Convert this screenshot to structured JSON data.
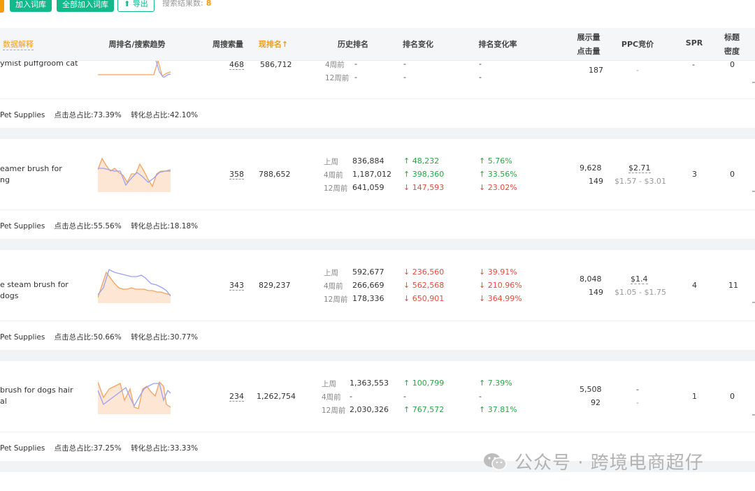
{
  "toolbar": {
    "add_btn": "加入词库",
    "add_all_btn": "全部加入词库",
    "export_btn": "导出",
    "result_label": "搜索结果数:",
    "result_count": "8"
  },
  "header": {
    "data_explain": "数据解释",
    "trend": "周排名/搜索趋势",
    "weekly_search": "周搜索量",
    "current_rank": "现排名↑",
    "history_rank": "历史排名",
    "rank_change": "排名变化",
    "rank_change_rate": "排名变化率",
    "impressions": "展示量",
    "clicks": "点击量",
    "ppc": "PPC竞价",
    "spr": "SPR",
    "title_density_1": "标题",
    "title_density_2": "密度"
  },
  "rows": [
    {
      "keyword_1": "ymist puffgroom cat",
      "keyword_2": "",
      "weekly_search": "468",
      "current_rank": "586,712",
      "hist": [
        {
          "label": "4周前",
          "value": "-",
          "change": "-",
          "rate": "-"
        },
        {
          "label": "12周前",
          "value": "-",
          "change": "-",
          "rate": "-"
        }
      ],
      "impressions": "",
      "clicks": "187",
      "ppc": "-",
      "ppc_range": "",
      "spr": "-",
      "density": "0",
      "category": "Pet Supplies",
      "click_share": "点击总占比:73.39%",
      "conv_share": "转化总占比:42.10%"
    },
    {
      "keyword_1": "eamer brush for",
      "keyword_2": "ng",
      "weekly_search": "358",
      "current_rank": "788,652",
      "hist": [
        {
          "label": "上周",
          "value": "836,884",
          "change": "48,232",
          "rate": "5.76%"
        },
        {
          "label": "4周前",
          "value": "1,187,012",
          "change": "398,360",
          "rate": "33.56%"
        },
        {
          "label": "12周前",
          "value": "641,059",
          "change": "147,593",
          "rate": "23.02%"
        }
      ],
      "impressions": "9,628",
      "clicks": "149",
      "ppc": "$2.71",
      "ppc_range": "$1.57 - $3.01",
      "spr": "3",
      "density": "0",
      "category": "Pet Supplies",
      "click_share": "点击总占比:55.56%",
      "conv_share": "转化总占比:18.18%"
    },
    {
      "keyword_1": "e steam brush for dogs",
      "keyword_2": "",
      "weekly_search": "343",
      "current_rank": "829,237",
      "hist": [
        {
          "label": "上周",
          "value": "592,677",
          "change": "236,560",
          "rate": "39.91%"
        },
        {
          "label": "4周前",
          "value": "266,669",
          "change": "562,568",
          "rate": "210.96%"
        },
        {
          "label": "12周前",
          "value": "178,336",
          "change": "650,901",
          "rate": "364.99%"
        }
      ],
      "impressions": "8,048",
      "clicks": "149",
      "ppc": "$1.4",
      "ppc_range": "$1.05 - $1.75",
      "spr": "4",
      "density": "11",
      "category": "Pet Supplies",
      "click_share": "点击总占比:50.66%",
      "conv_share": "转化总占比:30.77%"
    },
    {
      "keyword_1": "brush for dogs hair",
      "keyword_2": "al",
      "weekly_search": "234",
      "current_rank": "1,262,754",
      "hist": [
        {
          "label": "上周",
          "value": "1,363,553",
          "change": "100,799",
          "rate": "7.39%"
        },
        {
          "label": "4周前",
          "value": "-",
          "change": "-",
          "rate": "-"
        },
        {
          "label": "12周前",
          "value": "2,030,326",
          "change": "767,572",
          "rate": "37.81%"
        }
      ],
      "impressions": "5,508",
      "clicks": "92",
      "ppc": "-",
      "ppc_range": "-",
      "spr": "1",
      "density": "0",
      "category": "Pet Supplies",
      "click_share": "点击总占比:37.25%",
      "conv_share": "转化总占比:33.33%"
    }
  ],
  "watermark": "公众号 · 跨境电商超仔",
  "colors": {
    "accent": "#13b98a",
    "orange": "#f39c12",
    "up": "#27a745",
    "down": "#e74c3c"
  }
}
